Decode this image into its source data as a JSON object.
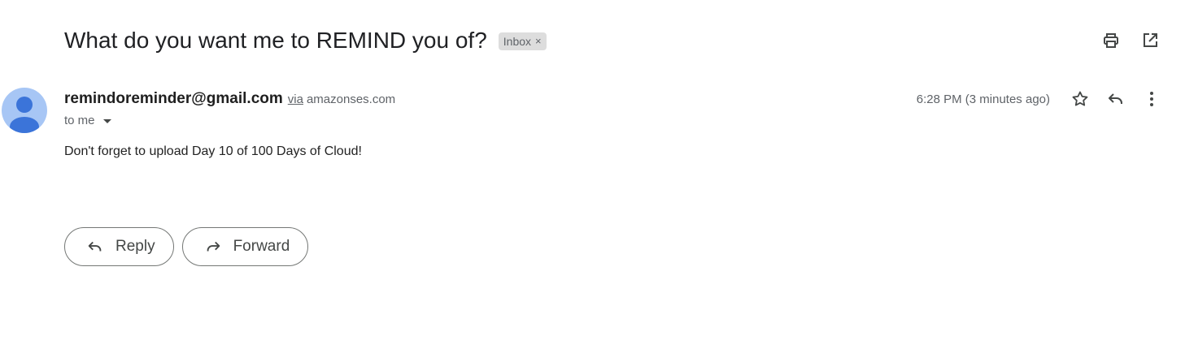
{
  "message": {
    "subject": "What do you want me to REMIND you of?",
    "label": {
      "text": "Inbox",
      "remove_glyph": "×"
    },
    "sender_email": "remindoreminder@gmail.com",
    "via_text": "via",
    "via_domain": "amazonses.com",
    "recipient_text": "to me",
    "timestamp": "6:28 PM (3 minutes ago)",
    "body": "Don't forget to upload Day 10 of 100 Days of Cloud!"
  },
  "header_icons": [
    "print-icon",
    "open-in-new-window-icon"
  ],
  "meta_icons": [
    "star-icon",
    "reply-icon",
    "more-vert-icon"
  ],
  "actions": {
    "reply_label": "Reply",
    "forward_label": "Forward"
  },
  "colors": {
    "avatar_bg": "#a7c6f5",
    "avatar_fg": "#3b74d9",
    "chip_bg": "#dddddd",
    "icon": "#444746"
  }
}
